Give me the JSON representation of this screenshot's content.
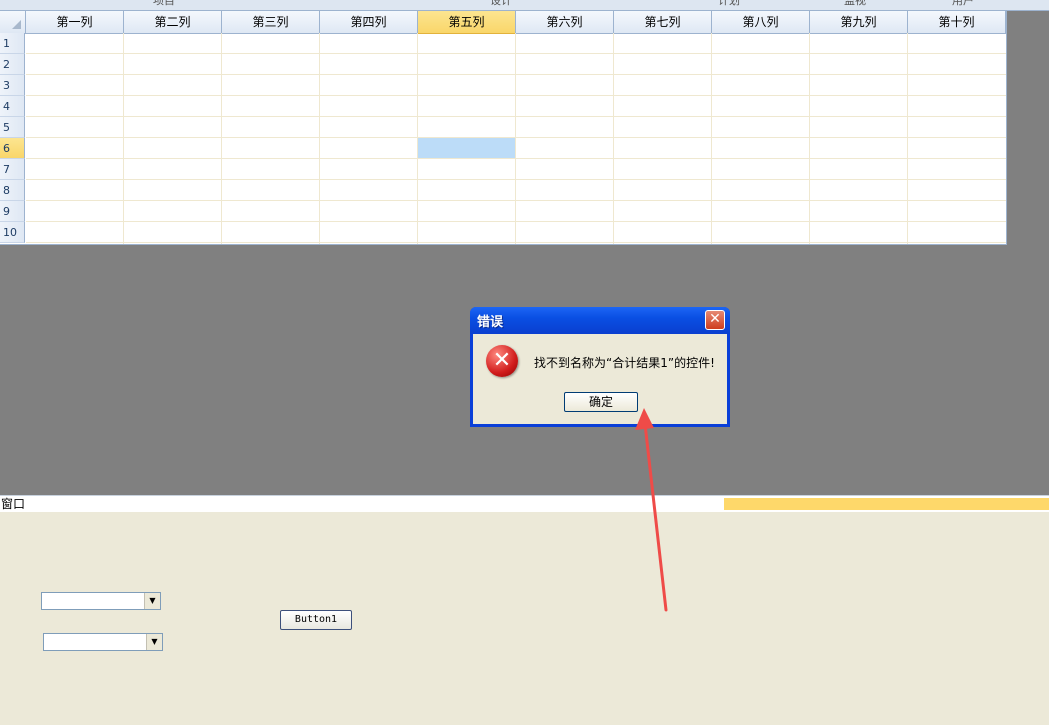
{
  "top_tabs": [
    "项目",
    "设计",
    "计划",
    "监视",
    "用户"
  ],
  "sheet": {
    "columns": [
      "第一列",
      "第二列",
      "第三列",
      "第四列",
      "第五列",
      "第六列",
      "第七列",
      "第八列",
      "第九列",
      "第十列"
    ],
    "rows": [
      "1",
      "2",
      "3",
      "4",
      "5",
      "6",
      "7",
      "8",
      "9",
      "10"
    ],
    "active_column": "第五列",
    "active_row": "6",
    "highlight_color": "#fad66a",
    "selection_color": "#bcdcf8"
  },
  "window_panel": {
    "title": "窗口",
    "button_label": "Button1",
    "combo1_value": "",
    "combo2_value": ""
  },
  "dialog": {
    "title": "错误",
    "message": "找不到名称为“合计结果1”的控件!",
    "ok_label": "确定",
    "icon": "error-icon",
    "title_color": "#0a4fe3"
  },
  "annotation": {
    "arrow_color": "#ef4b48"
  }
}
